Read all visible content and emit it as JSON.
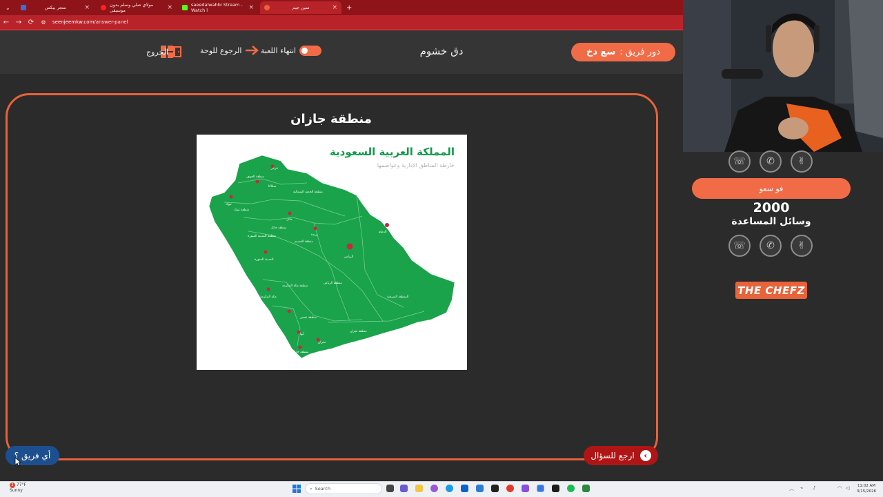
{
  "browser": {
    "tabs": [
      {
        "label": "متجر بيكس"
      },
      {
        "label": "مولاي صلي وسلم بدون موسيقى"
      },
      {
        "label": "saeedalwahbi Stream - Watch l"
      },
      {
        "label": "سين جيم"
      }
    ],
    "new_tab": "+",
    "url_host": "seenjeemkw.com",
    "url_path": "/answer-panel"
  },
  "header": {
    "turn_prefix": "دور فريق :",
    "turn_team": "سع دخ",
    "game_title": "دق خشوم",
    "end_game": "انتهاء اللعبة",
    "back_to_board": "الرجوع للوحة",
    "exit": "الخروج"
  },
  "answer": {
    "title": "منطقة جازان",
    "map": {
      "title": "المملكة العربية السعودية",
      "subtitle": "خارطة المناطق الإدارية وعواصمها",
      "labels": [
        "عرعر",
        "منطقة الجوف",
        "سكاكا",
        "منطقة الحدود الشمالية",
        "تبوك",
        "منطقة تبوك",
        "حائل",
        "منطقة حائل",
        "بريدة",
        "منطقة القصيم",
        "منطقة المدينة المنورة",
        "المدينة المنورة",
        "الرياض",
        "الدمام",
        "منطقة الرياض",
        "مكة المكرمة",
        "منطقة مكة المكرمة",
        "المنطقة الشرقية",
        "منطقة الباحة",
        "منطقة عسير",
        "أبها",
        "منطقة نجران",
        "نجران",
        "جازان",
        "منطقة جازان"
      ]
    }
  },
  "buttons": {
    "back_to_question": "ارجع للسؤال",
    "which_team": "أي فريق ؟"
  },
  "sidebar": {
    "team2_name": "فو سعو",
    "score": "2000",
    "helpers_label": "وسائل المساعدة",
    "sponsor": "THE CHEFZ"
  },
  "taskbar": {
    "weather_temp": "77°F",
    "weather_desc": "Sunny",
    "weather_badge": "2",
    "search_placeholder": "Search",
    "time": "11:02 AM",
    "date": "3/15/2026"
  }
}
